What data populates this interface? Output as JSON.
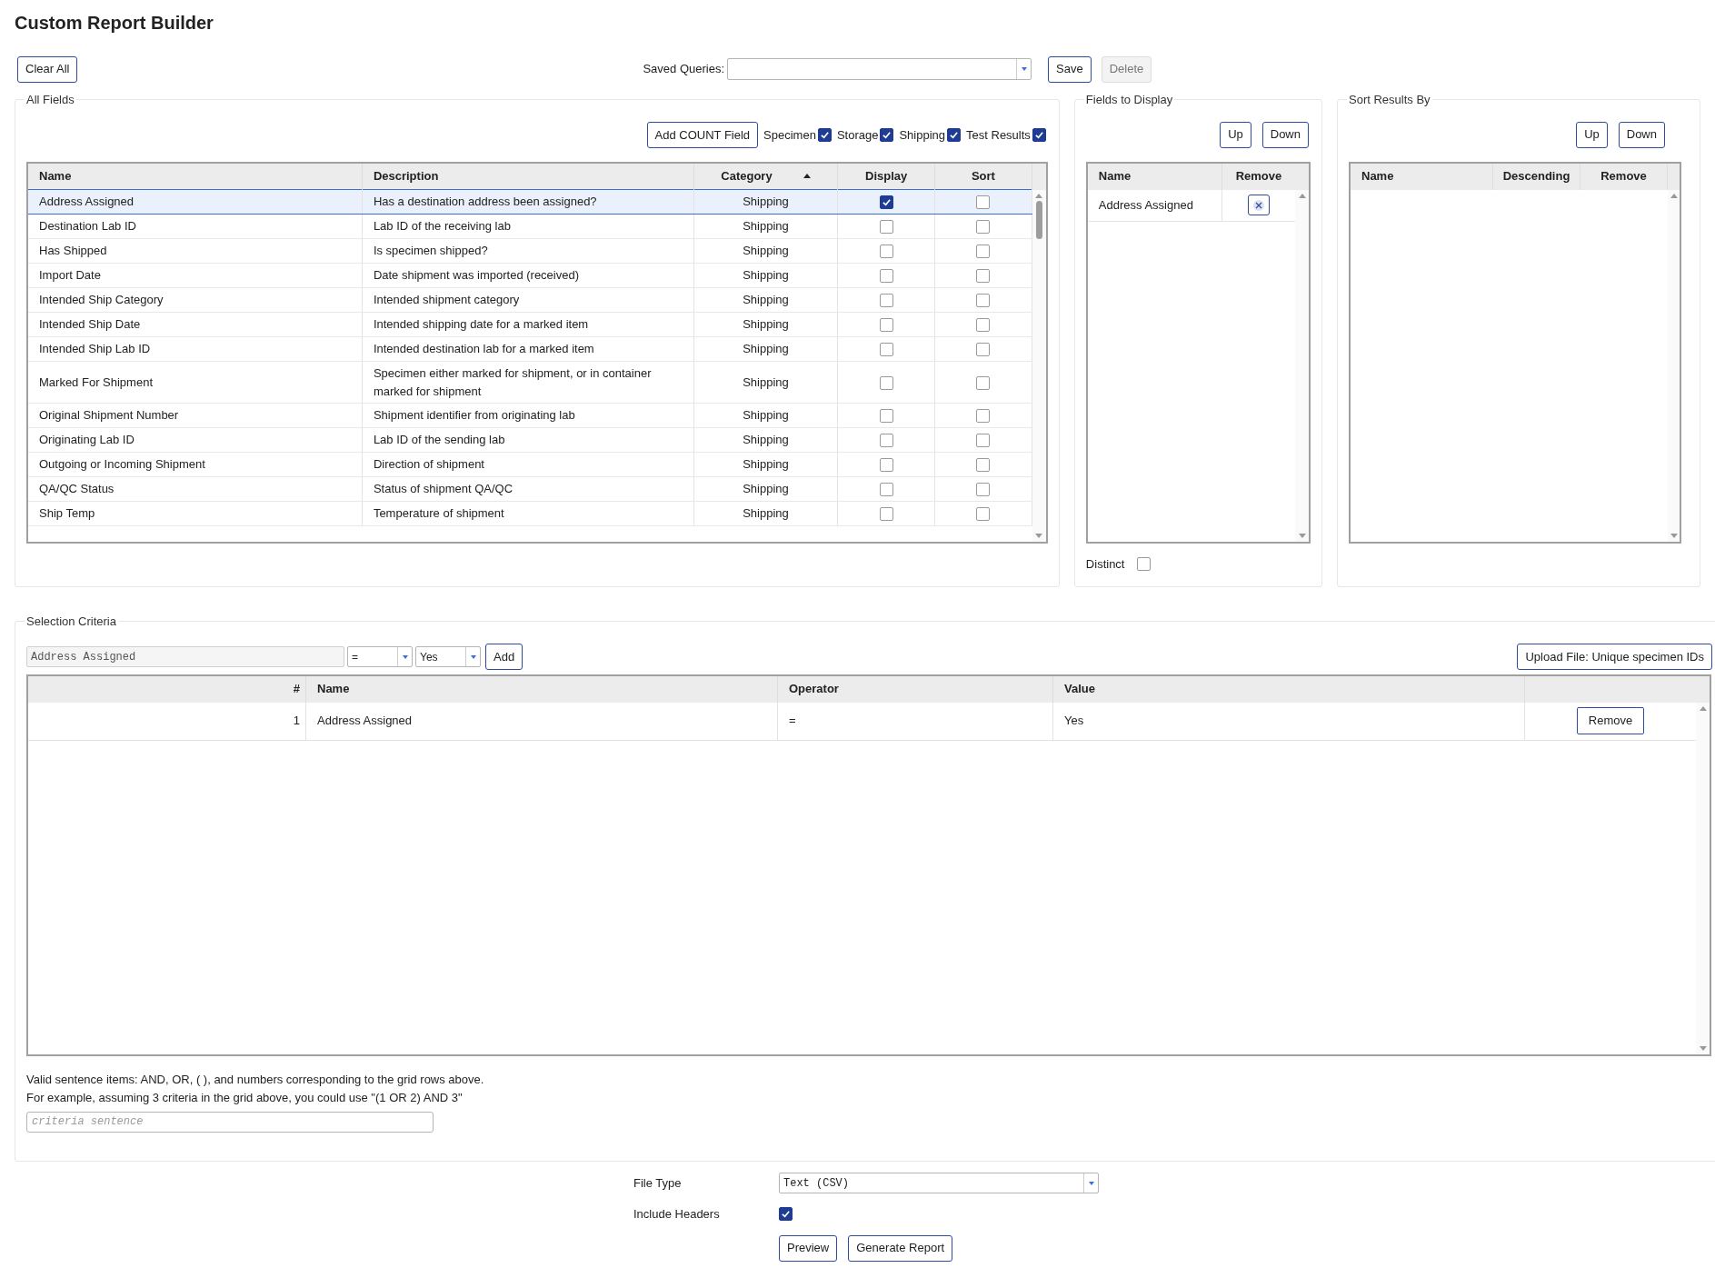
{
  "title": "Custom Report Builder",
  "toolbar": {
    "clear_button": "Clear All",
    "saved_queries_label": "Saved Queries:",
    "save_button": "Save",
    "delete_button": {
      "label": "Delete",
      "disabled": true
    }
  },
  "all_fields": {
    "legend": "All Fields",
    "add_count_button": "Add COUNT Field",
    "filters": [
      {
        "label": "Specimen",
        "checked": true
      },
      {
        "label": "Storage",
        "checked": true
      },
      {
        "label": "Shipping",
        "checked": true
      },
      {
        "label": "Test Results",
        "checked": true
      }
    ],
    "columns": [
      {
        "label": "Name",
        "sorted": false
      },
      {
        "label": "Description",
        "sorted": false
      },
      {
        "label": "Category",
        "sorted": true
      },
      {
        "label": "Display",
        "sorted": false
      },
      {
        "label": "Sort",
        "sorted": false
      }
    ],
    "rows": [
      {
        "name": "Address Assigned",
        "description": "Has a destination address been assigned?",
        "category": "Shipping",
        "display": true,
        "sort": false,
        "selected": true
      },
      {
        "name": "Destination Lab ID",
        "description": "Lab ID of the receiving lab",
        "category": "Shipping",
        "display": false,
        "sort": false,
        "selected": false
      },
      {
        "name": "Has Shipped",
        "description": "Is specimen shipped?",
        "category": "Shipping",
        "display": false,
        "sort": false,
        "selected": false
      },
      {
        "name": "Import Date",
        "description": "Date shipment was imported (received)",
        "category": "Shipping",
        "display": false,
        "sort": false,
        "selected": false
      },
      {
        "name": "Intended Ship Category",
        "description": "Intended shipment category",
        "category": "Shipping",
        "display": false,
        "sort": false,
        "selected": false
      },
      {
        "name": "Intended Ship Date",
        "description": "Intended shipping date for a marked item",
        "category": "Shipping",
        "display": false,
        "sort": false,
        "selected": false
      },
      {
        "name": "Intended Ship Lab ID",
        "description": "Intended destination lab for a marked item",
        "category": "Shipping",
        "display": false,
        "sort": false,
        "selected": false
      },
      {
        "name": "Marked For Shipment",
        "description": "Specimen either marked for shipment, or in container marked for shipment",
        "category": "Shipping",
        "display": false,
        "sort": false,
        "selected": false
      },
      {
        "name": "Original Shipment Number",
        "description": "Shipment identifier from originating lab",
        "category": "Shipping",
        "display": false,
        "sort": false,
        "selected": false
      },
      {
        "name": "Originating Lab ID",
        "description": "Lab ID of the sending lab",
        "category": "Shipping",
        "display": false,
        "sort": false,
        "selected": false
      },
      {
        "name": "Outgoing or Incoming Shipment",
        "description": "Direction of shipment",
        "category": "Shipping",
        "display": false,
        "sort": false,
        "selected": false
      },
      {
        "name": "QA/QC Status",
        "description": "Status of shipment QA/QC",
        "category": "Shipping",
        "display": false,
        "sort": false,
        "selected": false
      },
      {
        "name": "Ship Temp",
        "description": "Temperature of shipment",
        "category": "Shipping",
        "display": false,
        "sort": false,
        "selected": false
      }
    ]
  },
  "fields_to_display": {
    "legend": "Fields to Display",
    "up_button": "Up",
    "down_button": "Down",
    "columns": [
      "Name",
      "Remove"
    ],
    "rows": [
      {
        "name": "Address Assigned"
      }
    ],
    "distinct": {
      "label": "Distinct",
      "checked": false
    }
  },
  "sort_results_by": {
    "legend": "Sort Results By",
    "up_button": "Up",
    "down_button": "Down",
    "columns": [
      "Name",
      "Descending",
      "Remove"
    ]
  },
  "selection_criteria": {
    "legend": "Selection Criteria",
    "field_value": "Address Assigned",
    "operator": "=",
    "value": "Yes",
    "add_button": "Add",
    "upload_button": "Upload File: Unique specimen IDs",
    "columns": [
      "#",
      "Name",
      "Operator",
      "Value"
    ],
    "rows": [
      {
        "number": "1",
        "name": "Address Assigned",
        "operator": "=",
        "value": "Yes",
        "remove_button": "Remove"
      }
    ],
    "help_lines": [
      "Valid sentence items: AND, OR, ( ), and numbers corresponding to the grid rows above.",
      "For example, assuming 3 criteria in the grid above, you could use \"(1 OR 2) AND 3\""
    ],
    "sentence_placeholder": "criteria sentence"
  },
  "export": {
    "file_type": {
      "label": "File Type",
      "value": "Text (CSV)"
    },
    "include_headers": {
      "label": "Include Headers",
      "checked": true
    },
    "buttons": [
      "Preview",
      "Generate Report"
    ]
  }
}
